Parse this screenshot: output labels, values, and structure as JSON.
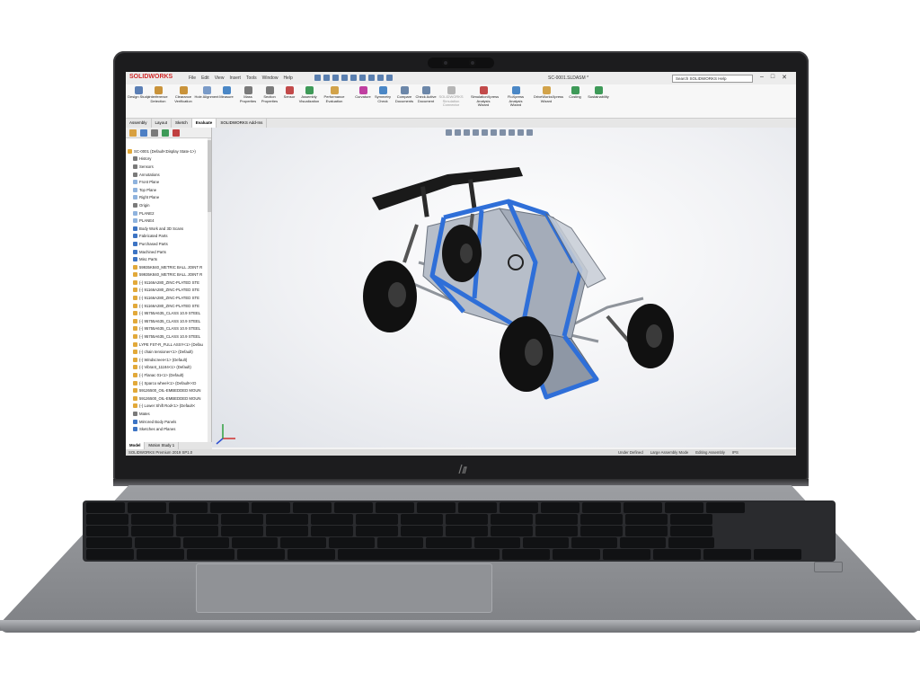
{
  "app": {
    "logo": "SOLIDWORKS",
    "menu": [
      "File",
      "Edit",
      "View",
      "Insert",
      "Tools",
      "Window",
      "Help"
    ],
    "document_title": "SC-0001.SLDASM *",
    "search_placeholder": "Search SOLIDWORKS Help",
    "window_controls": [
      "–",
      "□",
      "✕"
    ]
  },
  "ribbon": {
    "tools": [
      {
        "label": "Design Study",
        "color": "#5b7fb5",
        "dim": false
      },
      {
        "label": "Interference Detection",
        "color": "#c9933a",
        "dim": false
      },
      {
        "label": "Clearance Verification",
        "color": "#c9933a",
        "dim": false
      },
      {
        "label": "Hole Alignment",
        "color": "#7a9bc8",
        "dim": false
      },
      {
        "label": "Measure",
        "color": "#4a87c6",
        "dim": false
      },
      {
        "label": "Mass Properties",
        "color": "#7a7a7a",
        "dim": false
      },
      {
        "label": "Section Properties",
        "color": "#7a7a7a",
        "dim": false
      },
      {
        "label": "Sensor",
        "color": "#c24a4a",
        "dim": false
      },
      {
        "label": "Assembly Visualization",
        "color": "#3e9a58",
        "dim": false
      },
      {
        "label": "Performance Evaluation",
        "color": "#d2a34a",
        "dim": false
      },
      {
        "label": "Curvature",
        "color": "#c03fa0",
        "dim": false
      },
      {
        "label": "Symmetry Check",
        "color": "#4a87c6",
        "dim": false
      },
      {
        "label": "Compare Documents",
        "color": "#6c87a9",
        "dim": false
      },
      {
        "label": "Check Active Document",
        "color": "#6c87a9",
        "dim": false
      },
      {
        "label": "SOLIDWORKS Simulation Connector",
        "color": "#b5b5b5",
        "dim": true
      },
      {
        "label": "SimulationXpress Analysis Wizard",
        "color": "#c24a4a",
        "dim": false
      },
      {
        "label": "FloXpress Analysis Wizard",
        "color": "#4a87c6",
        "dim": false
      },
      {
        "label": "DriveWorksXpress Wizard",
        "color": "#d2a34a",
        "dim": false
      },
      {
        "label": "Costing",
        "color": "#3e9a58",
        "dim": false
      },
      {
        "label": "Sustainability",
        "color": "#3e9a58",
        "dim": false
      }
    ]
  },
  "command_tabs": [
    "Assembly",
    "Layout",
    "Sketch",
    "Evaluate",
    "SOLIDWORKS Add-Ins"
  ],
  "active_command_tab": "Evaluate",
  "feature_tree": {
    "root": "SC-0001 (Default<Display State-1>)",
    "nodes": [
      {
        "label": "History",
        "icon": "other"
      },
      {
        "label": "Sensors",
        "icon": "other"
      },
      {
        "label": "Annotations",
        "icon": "other"
      },
      {
        "label": "Front Plane",
        "icon": "plane"
      },
      {
        "label": "Top Plane",
        "icon": "plane"
      },
      {
        "label": "Right Plane",
        "icon": "plane"
      },
      {
        "label": "Origin",
        "icon": "other"
      },
      {
        "label": "PLANE2",
        "icon": "plane"
      },
      {
        "label": "PLANE4",
        "icon": "plane"
      },
      {
        "label": "Body Work and 3D Scans",
        "icon": "folder"
      },
      {
        "label": "Fabricated Parts",
        "icon": "folder"
      },
      {
        "label": "Purchased Parts",
        "icon": "folder"
      },
      {
        "label": "Machined Parts",
        "icon": "folder"
      },
      {
        "label": "Misc Parts",
        "icon": "folder"
      },
      {
        "label": "59935K840_METRIC BALL JOINT R",
        "icon": "part"
      },
      {
        "label": "59935K840_METRIC BALL JOINT R",
        "icon": "part"
      },
      {
        "label": "(-) 91166A280_ZINC-PLATED STE",
        "icon": "part"
      },
      {
        "label": "(-) 91166A280_ZINC-PLATED STE",
        "icon": "part"
      },
      {
        "label": "(-) 91166A280_ZINC-PLATED STE",
        "icon": "part"
      },
      {
        "label": "(-) 91166A280_ZINC-PLATED STE",
        "icon": "part"
      },
      {
        "label": "(-) 95755A635_CLASS 10.9 STEEL",
        "icon": "part"
      },
      {
        "label": "(-) 95755A635_CLASS 10.9 STEEL",
        "icon": "part"
      },
      {
        "label": "(-) 95755A635_CLASS 10.9 STEEL",
        "icon": "part"
      },
      {
        "label": "(-) 95755A635_CLASS 10.9 STEEL",
        "icon": "part"
      },
      {
        "label": "LYPE FST-R_FULL ASSY<1> (Defau",
        "icon": "part"
      },
      {
        "label": "(-) chain tensioner<1> (Default)",
        "icon": "part"
      },
      {
        "label": "(-) Windscreen<1> (Default)",
        "icon": "part"
      },
      {
        "label": "(-) Vibrant_11184<1> (Default)",
        "icon": "part"
      },
      {
        "label": "(-) Flanac 01<1> (Default)",
        "icon": "part"
      },
      {
        "label": "(-) Sparco wheel<1> (Default<<D",
        "icon": "part"
      },
      {
        "label": "59126500_OIL-EMBEDDED MOUN",
        "icon": "part"
      },
      {
        "label": "59126500_OIL-EMBEDDED MOUN",
        "icon": "part"
      },
      {
        "label": "(-) Lower Shift Rod<1> (Default<",
        "icon": "part"
      },
      {
        "label": "Mates",
        "icon": "other"
      },
      {
        "label": "Mirrored Body Panels",
        "icon": "folder"
      },
      {
        "label": "Sketches and Planes",
        "icon": "folder"
      }
    ]
  },
  "bottom_tabs": [
    "Model",
    "Motion Study 1"
  ],
  "status_bar": {
    "left": "SOLIDWORKS Premium 2019 SP1.0",
    "items": [
      "Under Defined",
      "Large Assembly Mode",
      "Editing Assembly",
      "IPS"
    ]
  },
  "colors": {
    "frame_blue": "#2f6fd8",
    "body_panels": "#aeb6c4",
    "tire": "#111111",
    "wing": "#1a1a1a"
  }
}
